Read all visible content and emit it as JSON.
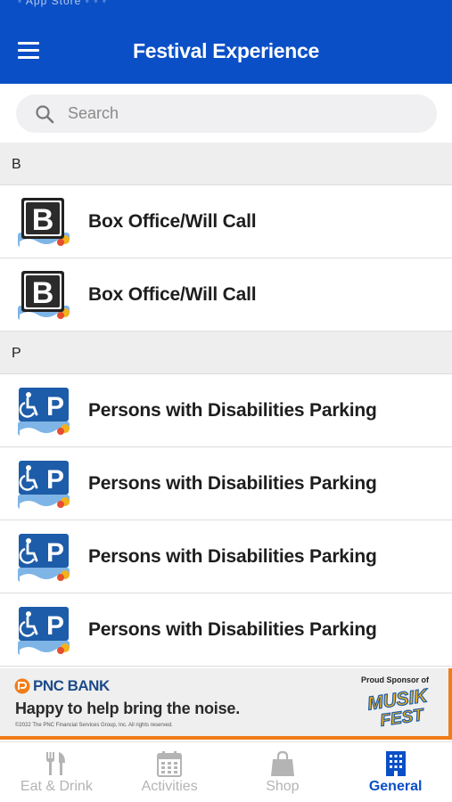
{
  "header": {
    "status_text": "◦ App Store ◦ ◦ ◦",
    "title": "Festival Experience"
  },
  "search": {
    "placeholder": "Search"
  },
  "sections": [
    {
      "letter": "B",
      "items": [
        {
          "label": "Box Office/Will Call",
          "icon": "box-office-icon"
        },
        {
          "label": "Box Office/Will Call",
          "icon": "box-office-icon"
        }
      ]
    },
    {
      "letter": "P",
      "items": [
        {
          "label": "Persons with Disabilities Parking",
          "icon": "accessible-parking-icon"
        },
        {
          "label": "Persons with Disabilities Parking",
          "icon": "accessible-parking-icon"
        },
        {
          "label": "Persons with Disabilities Parking",
          "icon": "accessible-parking-icon"
        },
        {
          "label": "Persons with Disabilities Parking",
          "icon": "accessible-parking-icon"
        }
      ]
    }
  ],
  "banner": {
    "brand": "PNC BANK",
    "tagline": "Happy to help bring the noise.",
    "legal": "©2022 The PNC Financial Services Group, Inc. All rights reserved.",
    "sponsor_label": "Proud Sponsor of",
    "logo_text_1": "MUSIK",
    "logo_text_2": "FEST"
  },
  "tabs": [
    {
      "label": "Eat & Drink",
      "icon": "fork-knife-icon",
      "active": false
    },
    {
      "label": "Activities",
      "icon": "calendar-icon",
      "active": false
    },
    {
      "label": "Shop",
      "icon": "shopping-bag-icon",
      "active": false
    },
    {
      "label": "General",
      "icon": "building-icon",
      "active": true
    }
  ],
  "colors": {
    "primary": "#0a4fc6",
    "banner_accent": "#f07d1a",
    "inactive_tab": "#b4b4b4"
  }
}
